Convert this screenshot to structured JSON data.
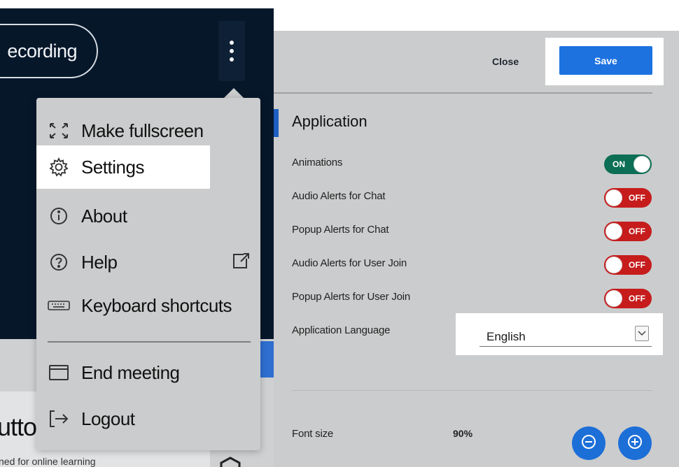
{
  "recording": {
    "label": "ecording"
  },
  "menu": {
    "items": [
      {
        "label": "Make fullscreen",
        "icon": "fullscreen-icon"
      },
      {
        "label": "Settings",
        "icon": "gear-icon"
      },
      {
        "label": "About",
        "icon": "info-icon"
      },
      {
        "label": "Help",
        "icon": "help-icon"
      },
      {
        "label": "Keyboard shortcuts",
        "icon": "keyboard-icon"
      },
      {
        "label": "End meeting",
        "icon": "window-icon"
      },
      {
        "label": "Logout",
        "icon": "logout-icon"
      }
    ]
  },
  "background": {
    "card_title": "utto",
    "card_subtitle": "ned for online learning"
  },
  "settings": {
    "close_label": "Close",
    "save_label": "Save",
    "section_title": "Application",
    "rows": [
      {
        "label": "Animations",
        "state": "ON"
      },
      {
        "label": "Audio Alerts for Chat",
        "state": "OFF"
      },
      {
        "label": "Popup Alerts for Chat",
        "state": "OFF"
      },
      {
        "label": "Audio Alerts for User Join",
        "state": "OFF"
      },
      {
        "label": "Popup Alerts for User Join",
        "state": "OFF"
      }
    ],
    "language_label": "Application Language",
    "language_value": "English",
    "font_size_label": "Font size",
    "font_size_value": "90%"
  },
  "colors": {
    "save_blue": "#1d72e0",
    "toggle_on": "#0b6e55",
    "toggle_off": "#c61c1c",
    "header_dark": "#06172a"
  }
}
